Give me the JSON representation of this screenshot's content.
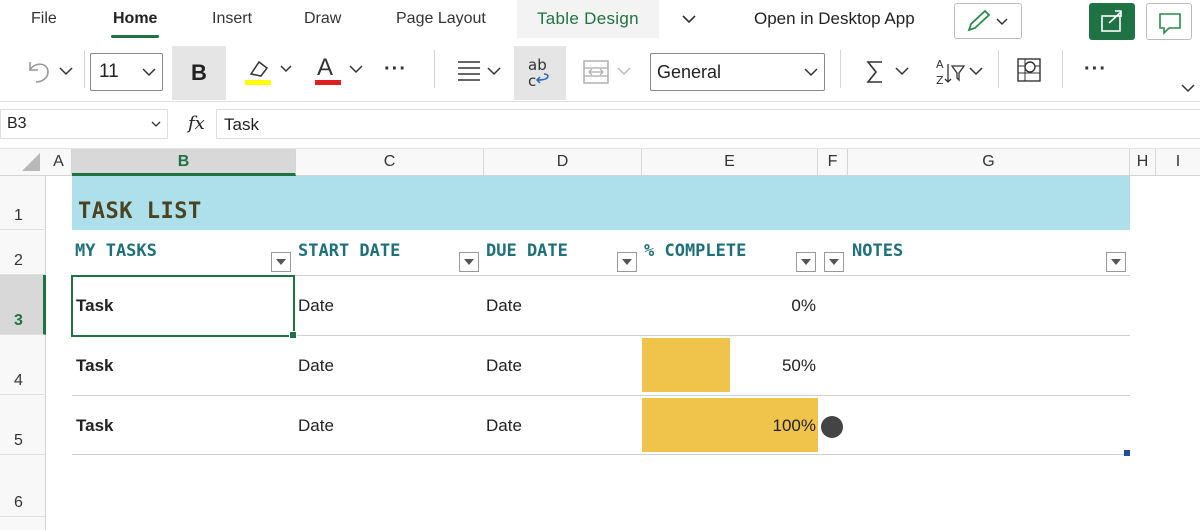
{
  "ribbon": {
    "tabs": [
      "File",
      "Home",
      "Insert",
      "Draw",
      "Page Layout",
      "Table Design"
    ],
    "open_desktop": "Open in Desktop App"
  },
  "toolbar": {
    "font_size": "11",
    "bold_label": "B",
    "font_color_label": "A",
    "number_format": "General",
    "more": "···",
    "highlight_color": "#ffff00",
    "font_color": "#e02020"
  },
  "formula_bar": {
    "name_box": "B3",
    "fx": "fx",
    "value": "Task"
  },
  "grid": {
    "columns": [
      "A",
      "B",
      "C",
      "D",
      "E",
      "F",
      "G",
      "H",
      "I"
    ],
    "rows": [
      "1",
      "2",
      "3",
      "4",
      "5",
      "6"
    ],
    "selected_column": "B",
    "selected_row": "3"
  },
  "table": {
    "title": "TASK LIST",
    "headers": [
      "MY TASKS",
      "START DATE",
      "DUE DATE",
      "% COMPLETE",
      "NOTES"
    ],
    "rows": [
      {
        "task": "Task",
        "start": "Date",
        "due": "Date",
        "complete": "0%",
        "complete_fraction": 0.0
      },
      {
        "task": "Task",
        "start": "Date",
        "due": "Date",
        "complete": "50%",
        "complete_fraction": 0.5
      },
      {
        "task": "Task",
        "start": "Date",
        "due": "Date",
        "complete": "100%",
        "complete_fraction": 1.0
      }
    ],
    "band_color": "#aee0ec",
    "bar_color": "#f0c34a",
    "header_color": "#20707a"
  },
  "icons": [
    "undo-icon",
    "highlighter-icon",
    "align-icon",
    "wrap-text-icon",
    "merge-icon",
    "autosum-icon",
    "sort-filter-icon",
    "analyze-icon",
    "pen-icon",
    "share-icon",
    "comment-icon"
  ]
}
